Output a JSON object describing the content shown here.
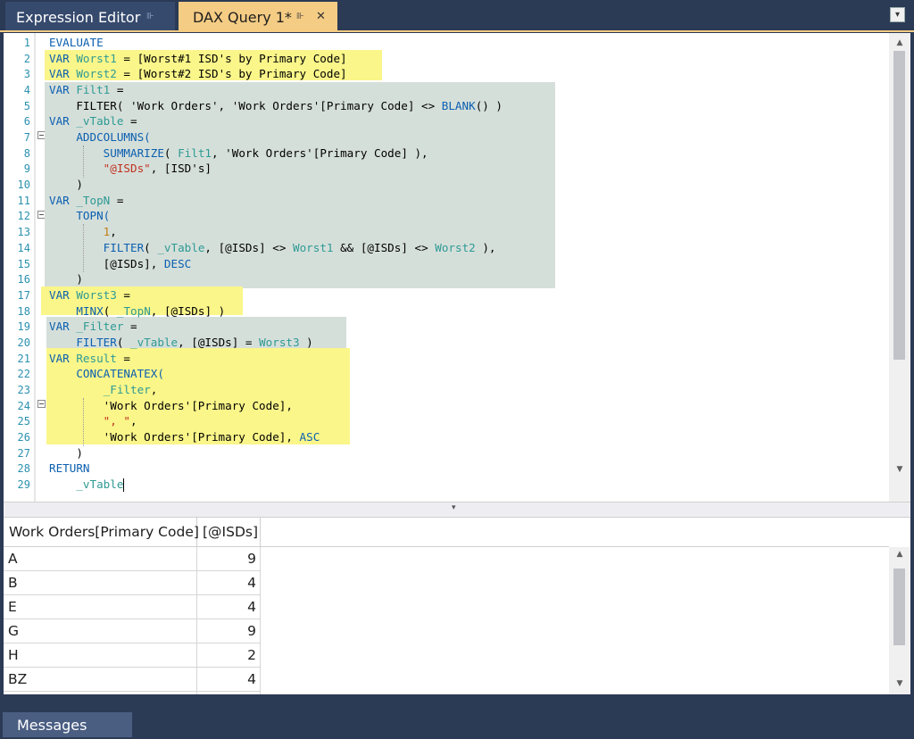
{
  "tabs": [
    {
      "label": "Expression Editor",
      "pin": "⊪"
    },
    {
      "label": "DAX Query 1*",
      "pin": "⊪",
      "close": "✕"
    }
  ],
  "tab_menu": "▾",
  "code_lines": [
    [
      [
        "EVALUATE",
        "k"
      ]
    ],
    [
      [
        "VAR ",
        "k"
      ],
      [
        "Worst1",
        "v"
      ],
      [
        " = [Worst#1 ISD's by Primary Code]",
        ""
      ]
    ],
    [
      [
        "VAR ",
        "k"
      ],
      [
        "Worst2",
        "v"
      ],
      [
        " = [Worst#2 ISD's by Primary Code]",
        ""
      ]
    ],
    [
      [
        "VAR ",
        "k"
      ],
      [
        "Filt1",
        "v"
      ],
      [
        " =",
        ""
      ]
    ],
    [
      [
        "    FILTER( 'Work Orders', 'Work Orders'[Primary Code] <> ",
        ""
      ],
      [
        "BLANK",
        "k"
      ],
      [
        "() )",
        ""
      ]
    ],
    [
      [
        "VAR ",
        "k"
      ],
      [
        "_vTable",
        "v"
      ],
      [
        " =",
        ""
      ]
    ],
    [
      [
        "    ADDCOLUMNS(",
        "k"
      ]
    ],
    [
      [
        "        ",
        ""
      ],
      [
        "SUMMARIZE",
        "k"
      ],
      [
        "( ",
        ""
      ],
      [
        "Filt1",
        "v"
      ],
      [
        ", 'Work Orders'[Primary Code] ),",
        ""
      ]
    ],
    [
      [
        "        ",
        ""
      ],
      [
        "\"@ISDs\"",
        "s"
      ],
      [
        ", [ISD's]",
        ""
      ]
    ],
    [
      [
        "    )",
        ""
      ]
    ],
    [
      [
        "VAR ",
        "k"
      ],
      [
        "_TopN",
        "v"
      ],
      [
        " =",
        ""
      ]
    ],
    [
      [
        "    TOPN(",
        "k"
      ]
    ],
    [
      [
        "        ",
        ""
      ],
      [
        "1",
        "n"
      ],
      [
        ",",
        ""
      ]
    ],
    [
      [
        "        ",
        ""
      ],
      [
        "FILTER",
        "k"
      ],
      [
        "( ",
        ""
      ],
      [
        "_vTable",
        "v"
      ],
      [
        ", [@ISDs] <> ",
        ""
      ],
      [
        "Worst1",
        "v"
      ],
      [
        " && [@ISDs] <> ",
        ""
      ],
      [
        "Worst2",
        "v"
      ],
      [
        " ),",
        ""
      ]
    ],
    [
      [
        "        [@ISDs], ",
        ""
      ],
      [
        "DESC",
        "k"
      ]
    ],
    [
      [
        "    )",
        ""
      ]
    ],
    [
      [
        "VAR ",
        "k"
      ],
      [
        "Worst3",
        "v"
      ],
      [
        " =",
        ""
      ]
    ],
    [
      [
        "    ",
        ""
      ],
      [
        "MINX",
        "k"
      ],
      [
        "( ",
        ""
      ],
      [
        "_TopN",
        "v"
      ],
      [
        ", [@ISDs] )",
        ""
      ]
    ],
    [
      [
        "VAR ",
        "k"
      ],
      [
        "_Filter",
        "v"
      ],
      [
        " =",
        ""
      ]
    ],
    [
      [
        "    ",
        ""
      ],
      [
        "FILTER",
        "k"
      ],
      [
        "( ",
        ""
      ],
      [
        "_vTable",
        "v"
      ],
      [
        ", [@ISDs] = ",
        ""
      ],
      [
        "Worst3",
        "v"
      ],
      [
        " )",
        ""
      ]
    ],
    [
      [
        "VAR ",
        "k"
      ],
      [
        "Result",
        "v"
      ],
      [
        " =",
        ""
      ]
    ],
    [
      [
        "    CONCATENATEX(",
        "k"
      ]
    ],
    [
      [
        "        ",
        ""
      ],
      [
        "_Filter",
        "v"
      ],
      [
        ",",
        ""
      ]
    ],
    [
      [
        "        'Work Orders'[Primary Code],",
        ""
      ]
    ],
    [
      [
        "        ",
        ""
      ],
      [
        "\", \"",
        "s"
      ],
      [
        ",",
        ""
      ]
    ],
    [
      [
        "        'Work Orders'[Primary Code], ",
        ""
      ],
      [
        "ASC",
        "k"
      ]
    ],
    [
      [
        "    )",
        ""
      ]
    ],
    [
      [
        "RETURN",
        "k"
      ]
    ],
    [
      [
        "    ",
        ""
      ],
      [
        "_vTable",
        "v"
      ]
    ]
  ],
  "line_numbers": [
    "1",
    "2",
    "3",
    "4",
    "5",
    "6",
    "7",
    "8",
    "9",
    "10",
    "11",
    "12",
    "13",
    "14",
    "15",
    "16",
    "17",
    "18",
    "19",
    "20",
    "21",
    "22",
    "23",
    "24",
    "25",
    "26",
    "27",
    "28",
    "29"
  ],
  "results": {
    "headers": [
      "Work Orders[Primary Code]",
      "[@ISDs]"
    ],
    "rows": [
      {
        "code": "A",
        "isds": "9"
      },
      {
        "code": "B",
        "isds": "4"
      },
      {
        "code": "E",
        "isds": "4"
      },
      {
        "code": "G",
        "isds": "9"
      },
      {
        "code": "H",
        "isds": "2"
      },
      {
        "code": "BZ",
        "isds": "4"
      }
    ]
  },
  "bottom_tab": "Messages",
  "scroll_arrows": {
    "up": "▲",
    "down": "▼"
  },
  "splitter_glyph": "▾",
  "colors": {
    "keyword": "#0b5fb0",
    "variable": "#2e9a94",
    "string": "#c0311f",
    "number": "#c17d11",
    "highlight_yellow": "#faf68a",
    "highlight_gray": "#d5dfda",
    "active_tab": "#f5cc84"
  }
}
